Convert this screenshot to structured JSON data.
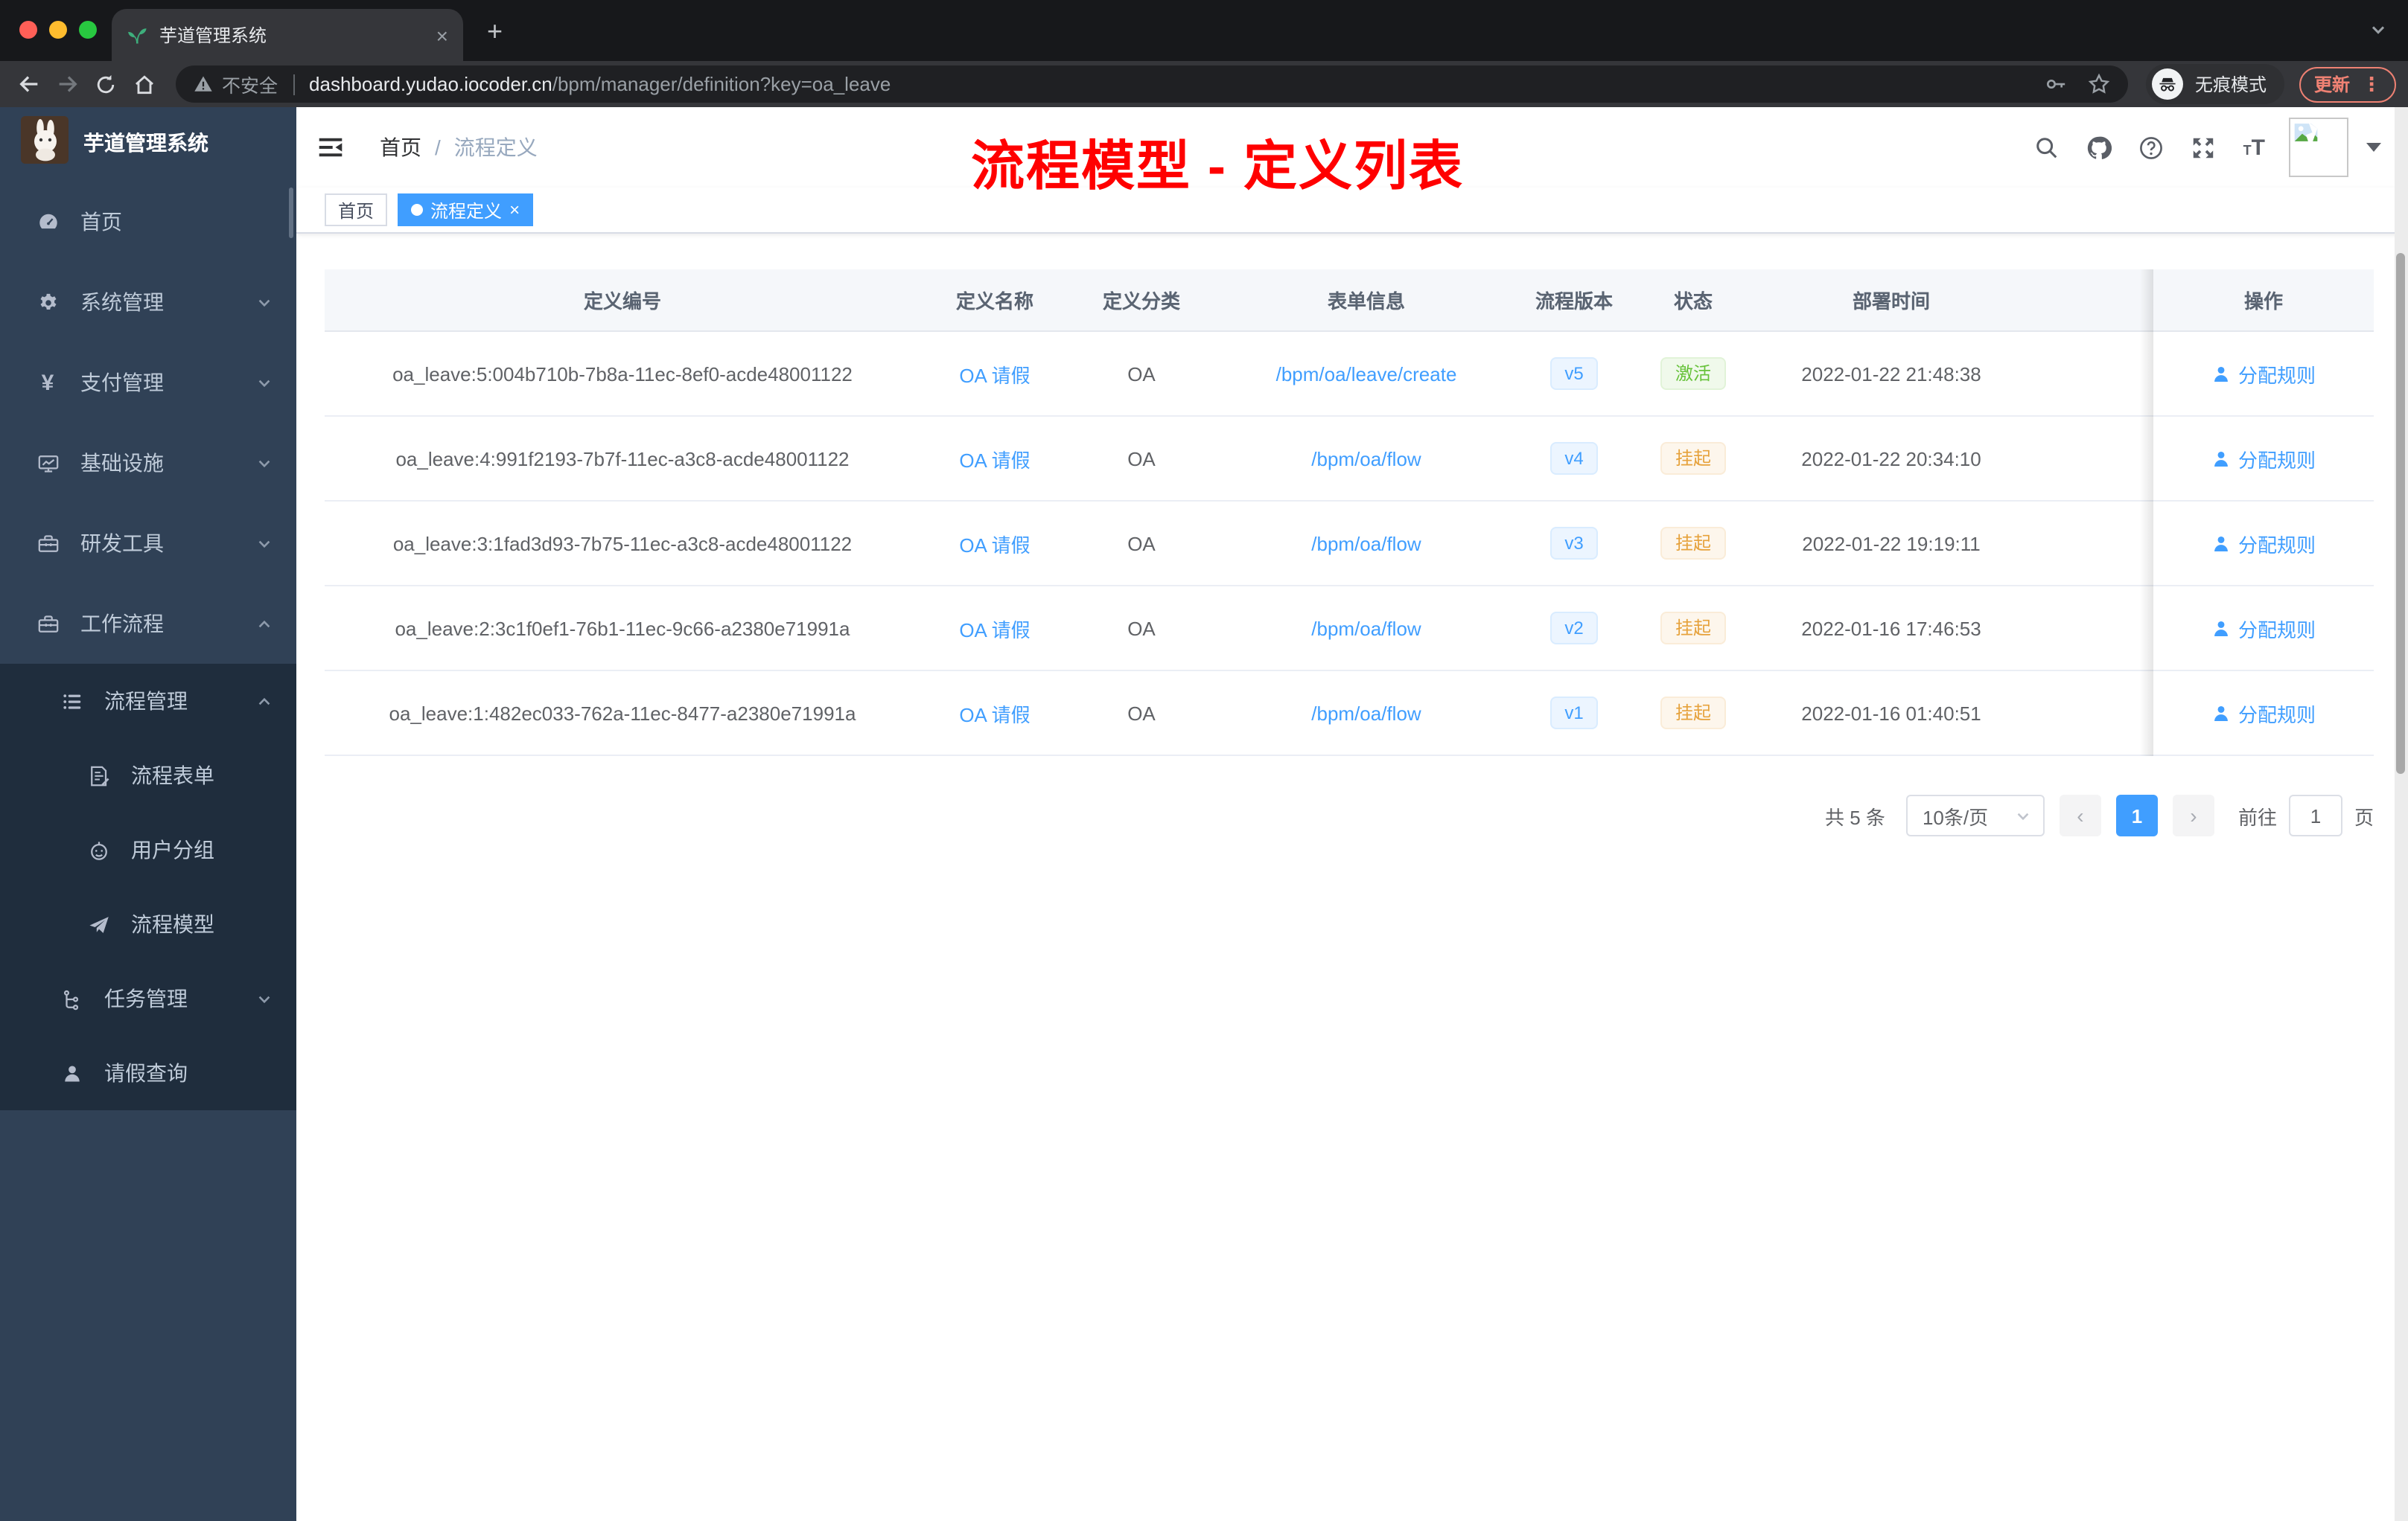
{
  "browser": {
    "tab": {
      "title": "芋道管理系统",
      "close": "×",
      "favicon": "sprout-icon"
    },
    "new_tab": "+",
    "toolbar": {
      "insecure_label": "不安全",
      "url_domain": "dashboard.yudao.iocoder.cn",
      "url_path": "/bpm/manager/definition?key=oa_leave",
      "incognito_label": "无痕模式",
      "update_label": "更新",
      "menu_dots": "⋮"
    }
  },
  "sidebar": {
    "logo_title": "芋道管理系统",
    "menu": [
      {
        "label": "首页",
        "icon": "dashboard-icon",
        "chevron": ""
      },
      {
        "label": "系统管理",
        "icon": "gear-icon",
        "chevron": "down"
      },
      {
        "label": "支付管理",
        "icon": "yen-icon",
        "chevron": "down"
      },
      {
        "label": "基础设施",
        "icon": "monitor-icon",
        "chevron": "down"
      },
      {
        "label": "研发工具",
        "icon": "toolbox-icon",
        "chevron": "down"
      },
      {
        "label": "工作流程",
        "icon": "briefcase-icon",
        "chevron": "up"
      }
    ],
    "submenu": [
      {
        "label": "流程管理",
        "icon": "flow-list-icon",
        "chevron": "up",
        "level": 2
      },
      {
        "label": "流程表单",
        "icon": "form-doc-icon",
        "chevron": "",
        "level": 3
      },
      {
        "label": "用户分组",
        "icon": "robot-icon",
        "chevron": "",
        "level": 3
      },
      {
        "label": "流程模型",
        "icon": "paper-plane-icon",
        "chevron": "",
        "level": 3
      },
      {
        "label": "任务管理",
        "icon": "tree-icon",
        "chevron": "down",
        "level": 2
      },
      {
        "label": "请假查询",
        "icon": "user-icon",
        "chevron": "",
        "level": 2
      }
    ]
  },
  "header": {
    "breadcrumb": {
      "home": "首页",
      "separator": "/",
      "current": "流程定义"
    },
    "font_size_small": "T",
    "font_size_big": "T"
  },
  "overlay_title": "流程模型 - 定义列表",
  "tags": {
    "home": "首页",
    "active_label": "流程定义",
    "active_close": "×"
  },
  "table": {
    "columns": [
      "定义编号",
      "定义名称",
      "定义分类",
      "表单信息",
      "流程版本",
      "状态",
      "部署时间",
      "操作"
    ],
    "rows": [
      {
        "id": "oa_leave:5:004b710b-7b8a-11ec-8ef0-acde48001122",
        "name": "OA 请假",
        "category": "OA",
        "form": "/bpm/oa/leave/create",
        "version": "v5",
        "status": "激活",
        "status_type": "active",
        "deploy_time": "2022-01-22 21:48:38",
        "action": "分配规则"
      },
      {
        "id": "oa_leave:4:991f2193-7b7f-11ec-a3c8-acde48001122",
        "name": "OA 请假",
        "category": "OA",
        "form": "/bpm/oa/flow",
        "version": "v4",
        "status": "挂起",
        "status_type": "suspended",
        "deploy_time": "2022-01-22 20:34:10",
        "action": "分配规则"
      },
      {
        "id": "oa_leave:3:1fad3d93-7b75-11ec-a3c8-acde48001122",
        "name": "OA 请假",
        "category": "OA",
        "form": "/bpm/oa/flow",
        "version": "v3",
        "status": "挂起",
        "status_type": "suspended",
        "deploy_time": "2022-01-22 19:19:11",
        "action": "分配规则"
      },
      {
        "id": "oa_leave:2:3c1f0ef1-76b1-11ec-9c66-a2380e71991a",
        "name": "OA 请假",
        "category": "OA",
        "form": "/bpm/oa/flow",
        "version": "v2",
        "status": "挂起",
        "status_type": "suspended",
        "deploy_time": "2022-01-16 17:46:53",
        "action": "分配规则"
      },
      {
        "id": "oa_leave:1:482ec033-762a-11ec-8477-a2380e71991a",
        "name": "OA 请假",
        "category": "OA",
        "form": "/bpm/oa/flow",
        "version": "v1",
        "status": "挂起",
        "status_type": "suspended",
        "deploy_time": "2022-01-16 01:40:51",
        "action": "分配规则"
      }
    ]
  },
  "pagination": {
    "total": "共 5 条",
    "page_size": "10条/页",
    "prev": "‹",
    "current_page": "1",
    "next": "›",
    "goto_label": "前往",
    "goto_value": "1",
    "unit_label": "页"
  },
  "colors": {
    "accent": "#409eff",
    "overlay_red": "#ff0000",
    "status_active_green": "#67c23a",
    "status_suspended_orange": "#e6a23c",
    "sidebar_bg": "#304156",
    "submenu_bg": "#1f2d3d",
    "sidebar_text": "#bfcbd9",
    "active_tag_bg": "#409eff"
  }
}
